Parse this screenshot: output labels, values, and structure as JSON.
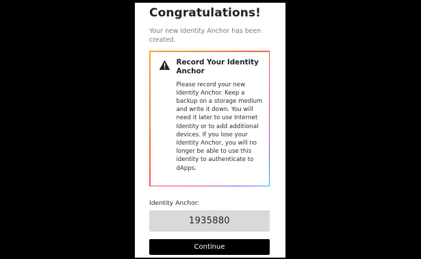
{
  "header": {
    "title": "Congratulations!",
    "subtitle": "Your new Identity Anchor has been created."
  },
  "warning": {
    "icon": "warning-icon",
    "title": "Record Your Identity Anchor",
    "body": "Please record your new Identity Anchor. Keep a backup on a storage medium and write it down. You will need it later to use Internet Identity or to add additional devices. If you lose your Identity Anchor, you will no longer be able to use this identity to authenticate to dApps."
  },
  "anchor": {
    "label": "Identity Anchor:",
    "value": "1935880"
  },
  "actions": {
    "continue_label": "Continue"
  },
  "colors": {
    "page_background": "#000000",
    "card_background": "#ffffff",
    "anchor_box": "#d9d9d9",
    "button": "#000000"
  }
}
